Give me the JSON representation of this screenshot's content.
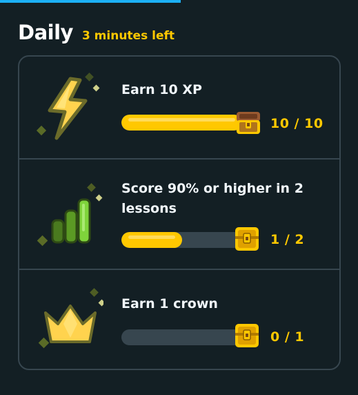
{
  "header": {
    "title": "Daily",
    "timer": "3 minutes left"
  },
  "quests": [
    {
      "label": "Earn 10 XP",
      "progress_text": "10 / 10",
      "progress": 1.0,
      "icon": "lightning-bolt-icon",
      "reward_icon": "open-treasure-chest-icon"
    },
    {
      "label": "Score 90% or higher in 2 lessons",
      "progress_text": "1 / 2",
      "progress": 0.5,
      "icon": "signal-bars-icon",
      "reward_icon": "treasure-chest-icon"
    },
    {
      "label": "Earn 1 crown",
      "progress_text": "0 / 1",
      "progress": 0.0,
      "icon": "crown-icon",
      "reward_icon": "treasure-chest-icon"
    }
  ],
  "colors": {
    "background": "#131f24",
    "card_border": "#37464f",
    "accent_gold": "#ffc800",
    "track": "#37464f",
    "chest_body": "#8a4b2a",
    "bolt": "#ffd34e",
    "bars_green": "#7fd43b",
    "crown": "#ffd34e"
  }
}
